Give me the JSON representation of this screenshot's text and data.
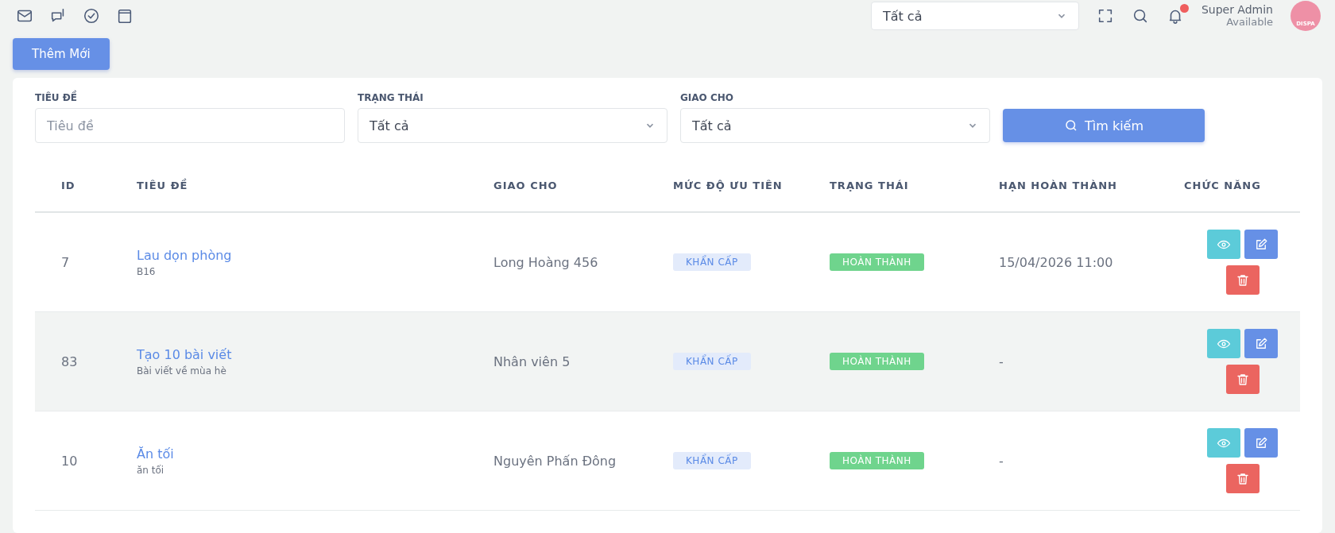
{
  "header": {
    "scope_select": {
      "value": "Tất cả"
    },
    "notifications": {
      "unread": true
    },
    "user": {
      "name": "Super Admin",
      "status": "Available",
      "avatar_text": "DISPA"
    }
  },
  "add_button": "Thêm Mới",
  "filters": [
    {
      "label": "TIÊU ĐỀ",
      "kind": "text",
      "placeholder": "Tiêu đề"
    },
    {
      "label": "TRẠNG THÁI",
      "kind": "select",
      "value": "Tất cả"
    },
    {
      "label": "GIAO CHO",
      "kind": "select",
      "value": "Tất cả"
    }
  ],
  "search_button": "Tìm kiếm",
  "table": {
    "columns": [
      "ID",
      "TIÊU ĐỀ",
      "GIAO CHO",
      "MỨC ĐỘ ƯU TIÊN",
      "TRẠNG THÁI",
      "HẠN HOÀN THÀNH",
      "CHỨC NĂNG"
    ],
    "rows": [
      {
        "id": "7",
        "title": "Lau dọn phòng",
        "subtitle": "B16",
        "assignee": "Long Hoàng 456",
        "priority": "KHẨN CẤP",
        "status": "HOÀN THÀNH",
        "deadline": "15/04/2026 11:00"
      },
      {
        "id": "83",
        "title": "Tạo 10 bài viết",
        "subtitle": "Bài viết về mùa hè",
        "assignee": "Nhân viên 5",
        "priority": "KHẨN CẤP",
        "status": "HOÀN THÀNH",
        "deadline": "-"
      },
      {
        "id": "10",
        "title": "Ăn tối",
        "subtitle": "ăn tối",
        "assignee": "Nguyên Phấn Đông",
        "priority": "KHẨN CẤP",
        "status": "HOÀN THÀNH",
        "deadline": "-"
      }
    ]
  }
}
